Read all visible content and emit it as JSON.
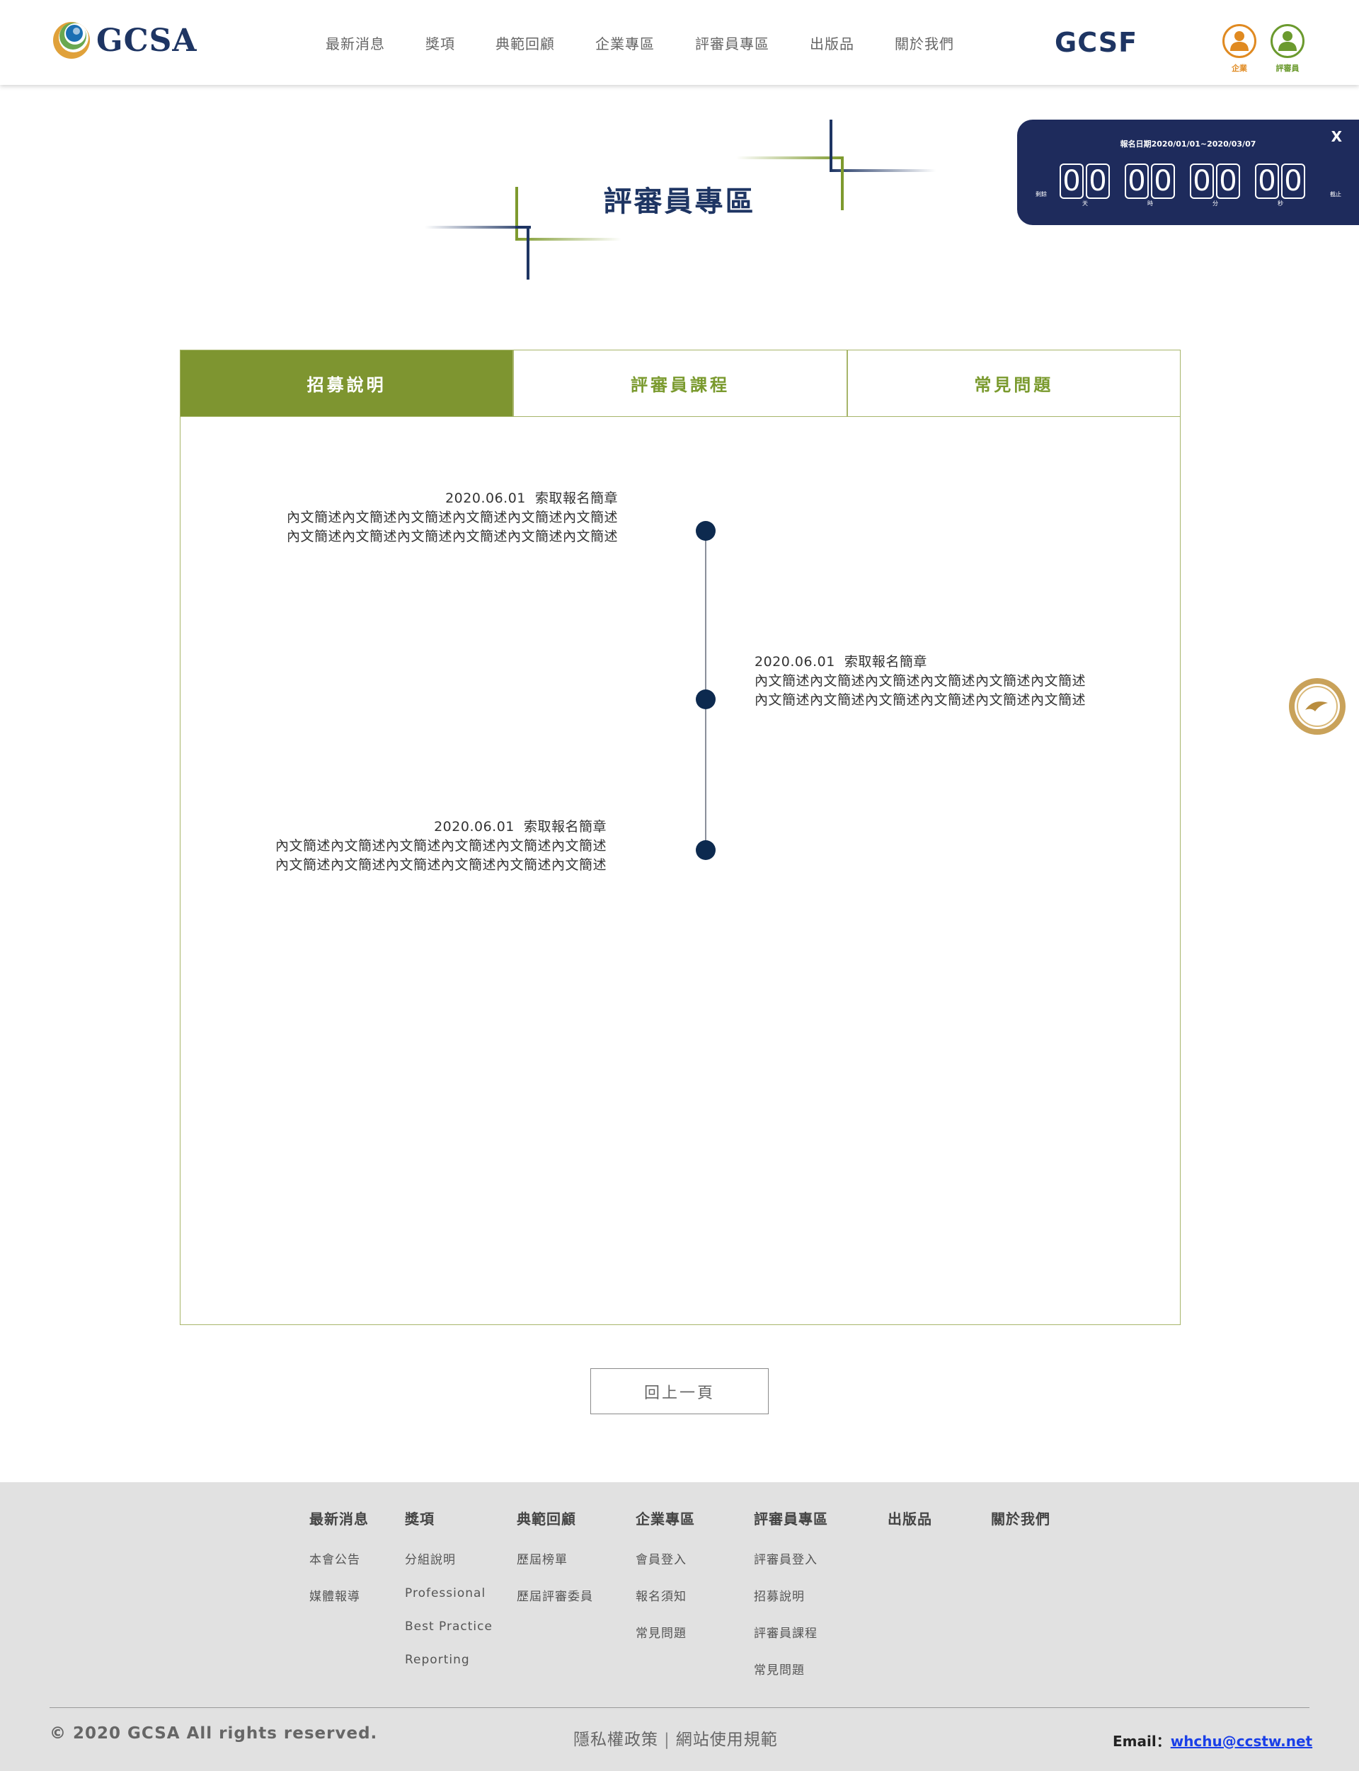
{
  "header": {
    "logo_text": "GCSA",
    "nav": [
      "最新消息",
      "獎項",
      "典範回顧",
      "企業專區",
      "評審員專區",
      "出版品",
      "關於我們"
    ],
    "partner_logo": "GCSF",
    "roles": [
      {
        "label": "企業",
        "icon": "person-icon",
        "color": "#e08a21"
      },
      {
        "label": "評審員",
        "icon": "person-icon",
        "color": "#6b9a2e"
      }
    ]
  },
  "countdown": {
    "period": "報名日期2020/01/01~2020/03/07",
    "prefix": "剩餘",
    "suffix": "截止",
    "close": "X",
    "units": [
      {
        "digits": [
          "0",
          "0"
        ],
        "label": "天"
      },
      {
        "digits": [
          "0",
          "0"
        ],
        "label": "時"
      },
      {
        "digits": [
          "0",
          "0"
        ],
        "label": "分"
      },
      {
        "digits": [
          "0",
          "0"
        ],
        "label": "秒"
      }
    ]
  },
  "page_title": "評審員專區",
  "tabs": [
    {
      "label": "招募說明",
      "active": true
    },
    {
      "label": "評審員課程",
      "active": false
    },
    {
      "label": "常見問題",
      "active": false
    }
  ],
  "timeline": [
    {
      "date": "2020.06.01",
      "title": "索取報名簡章",
      "lines": [
        "內文簡述內文簡述內文簡述內文簡述內文簡述內文簡述",
        "內文簡述內文簡述內文簡述內文簡述內文簡述內文簡述"
      ]
    },
    {
      "date": "2020.06.01",
      "title": "索取報名簡章",
      "lines": [
        "內文簡述內文簡述內文簡述內文簡述內文簡述內文簡述",
        "內文簡述內文簡述內文簡述內文簡述內文簡述內文簡述"
      ]
    },
    {
      "date": "2020.06.01",
      "title": "索取報名簡章",
      "lines": [
        "內文簡述內文簡述內文簡述內文簡述內文簡述內文簡述",
        "內文簡述內文簡述內文簡述內文簡述內文簡述內文簡述"
      ]
    }
  ],
  "back_button": "回上一頁",
  "footer": {
    "columns": [
      {
        "heading": "最新消息",
        "items": [
          "本會公告",
          "媒體報導"
        ]
      },
      {
        "heading": "獎項",
        "items": [
          "分組說明",
          "Professional",
          "Best Practice",
          "Reporting"
        ]
      },
      {
        "heading": "典範回顧",
        "items": [
          "歷屆榜單",
          "歷屆評審委員"
        ]
      },
      {
        "heading": "企業專區",
        "items": [
          "會員登入",
          "報名須知",
          "常見問題"
        ]
      },
      {
        "heading": "評審員專區",
        "items": [
          "評審員登入",
          "招募說明",
          "評審員課程",
          "常見問題"
        ]
      },
      {
        "heading": "出版品",
        "items": []
      },
      {
        "heading": "關於我們",
        "items": []
      }
    ],
    "copyright": "© 2020 GCSA All rights reserved.",
    "privacy": "隱私權政策",
    "separator": "|",
    "terms": "網站使用規範",
    "email_label": "Email：",
    "email": "whchu@ccstw.net"
  },
  "colors": {
    "navy": "#1e3563",
    "olive": "#7e9530",
    "orange": "#e08a21",
    "green": "#6b9a2e",
    "footer_bg": "#e1e1e1"
  }
}
